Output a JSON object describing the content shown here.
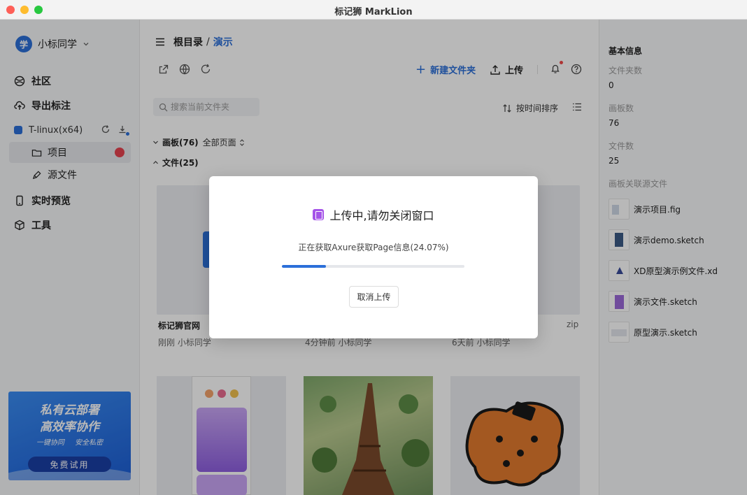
{
  "window": {
    "title": "标记狮 MarkLion"
  },
  "sidebar": {
    "user": {
      "avatar_text": "学",
      "name": "小标同学"
    },
    "nav": [
      {
        "label": "社区",
        "icon": "globe-icon"
      },
      {
        "label": "导出标注",
        "icon": "cloud-upload-icon"
      }
    ],
    "team": {
      "label": "T-linux(x64)",
      "color": "#2c6fd9"
    },
    "team_items": [
      {
        "label": "项目",
        "icon": "folder-icon",
        "active": true
      },
      {
        "label": "源文件",
        "icon": "pen-icon"
      }
    ],
    "nav2": [
      {
        "label": "实时预览",
        "icon": "phone-icon"
      },
      {
        "label": "工具",
        "icon": "cube-icon"
      }
    ],
    "promo": {
      "line1": "私有云部署",
      "line2": "高效率协作",
      "tag1": "一键协同",
      "tag2": "安全私密",
      "button": "免费试用"
    }
  },
  "main": {
    "breadcrumb": {
      "root": "根目录",
      "separator": "/",
      "current": "演示"
    },
    "toolbar": {
      "new_folder": "新建文件夹",
      "upload": "上传"
    },
    "search": {
      "placeholder": "搜索当前文件夹"
    },
    "sort": {
      "label": "按时间排序"
    },
    "sections": {
      "boards": {
        "label": "画板(76)",
        "control": "全部页面"
      },
      "files": {
        "label": "文件(25)"
      }
    },
    "cards": [
      {
        "name": "标记狮官网",
        "meta": "刚刚 小标同学",
        "tag": ""
      },
      {
        "name": "",
        "meta": "4分钟前 小标同学",
        "tag": ""
      },
      {
        "name": "",
        "meta": "6天前 小标同学",
        "tag": "zip"
      }
    ]
  },
  "info": {
    "title": "基本信息",
    "folders_label": "文件夹数",
    "folders_value": "0",
    "boards_label": "画板数",
    "boards_value": "76",
    "files_label": "文件数",
    "files_value": "25",
    "linked_label": "画板关联源文件",
    "linked_files": [
      {
        "name": "演示项目.fig"
      },
      {
        "name": "演示demo.sketch"
      },
      {
        "name": "XD原型演示例文件.xd"
      },
      {
        "name": "演示文件.sketch"
      },
      {
        "name": "原型演示.sketch"
      }
    ]
  },
  "modal": {
    "title": "上传中,请勿关闭窗口",
    "status": "正在获取Axure获取Page信息(24.07%)",
    "progress": 0.2407,
    "cancel": "取消上传"
  }
}
